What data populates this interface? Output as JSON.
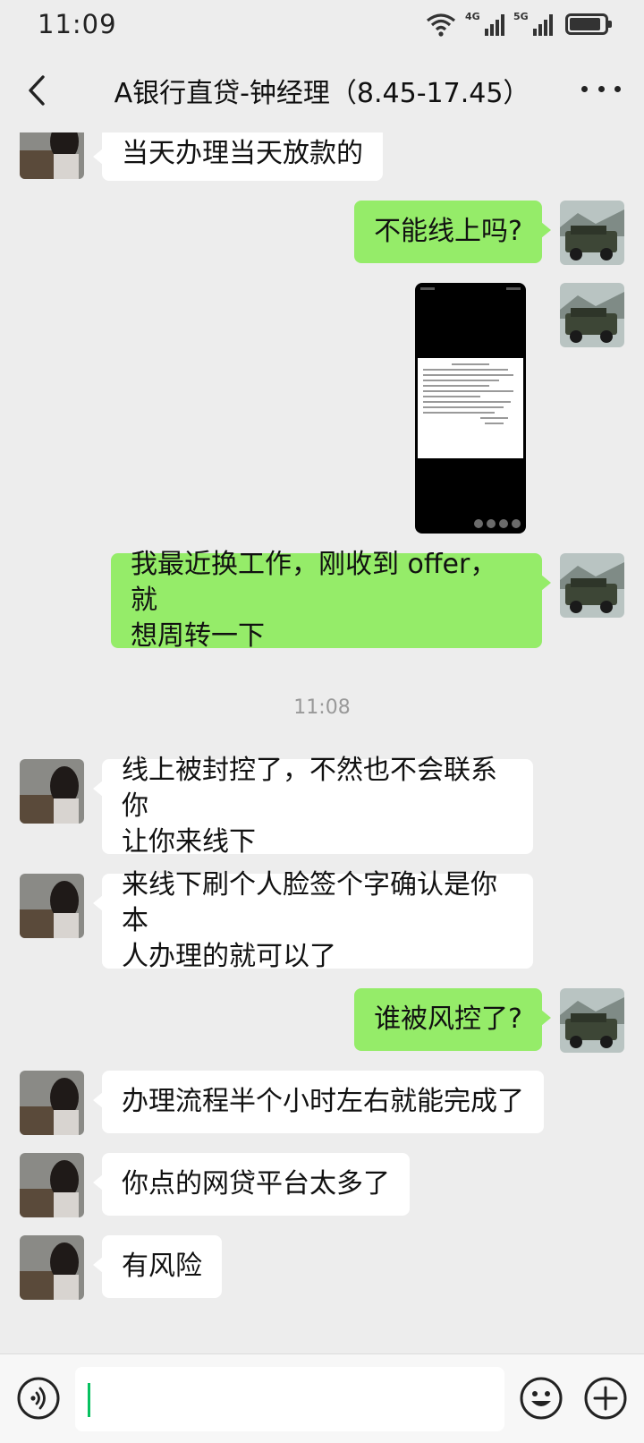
{
  "status_bar": {
    "time": "11:09",
    "signal_1_label": "4G",
    "signal_2_label": "5G",
    "icons": [
      "wifi-icon",
      "signal-4g-icon",
      "signal-5g-icon",
      "battery-icon"
    ]
  },
  "nav": {
    "title": "A银行直贷-钟经理（8.45-17.45）",
    "back_icon": "chevron-left-icon",
    "more_icon": "more-dots-icon"
  },
  "messages": [
    {
      "side": "left",
      "text": "当天办理当天放款的"
    },
    {
      "side": "right",
      "text": "不能线上吗?"
    },
    {
      "side": "right",
      "type": "image",
      "description_icon": "screenshot-image"
    },
    {
      "side": "right",
      "text_line1": "我最近换工作，刚收到 offer，就",
      "text_line2": "想周转一下"
    },
    {
      "type": "time",
      "text": "11:08"
    },
    {
      "side": "left",
      "text_line1": "线上被封控了，不然也不会联系你",
      "text_line2": "让你来线下"
    },
    {
      "side": "left",
      "text_line1": "来线下刷个人脸签个字确认是你本",
      "text_line2": "人办理的就可以了"
    },
    {
      "side": "right",
      "text": "谁被风控了?"
    },
    {
      "side": "left",
      "text": "办理流程半个小时左右就能完成了"
    },
    {
      "side": "left",
      "text": "你点的网贷平台太多了"
    },
    {
      "side": "left",
      "text": "有风险"
    }
  ],
  "input_bar": {
    "input_value": "",
    "icons": [
      "voice-icon",
      "emoji-icon",
      "plus-icon"
    ]
  },
  "colors": {
    "background": "#ededed",
    "bubble_self": "#95ec69",
    "bubble_other": "#ffffff",
    "cursor": "#07c160"
  }
}
